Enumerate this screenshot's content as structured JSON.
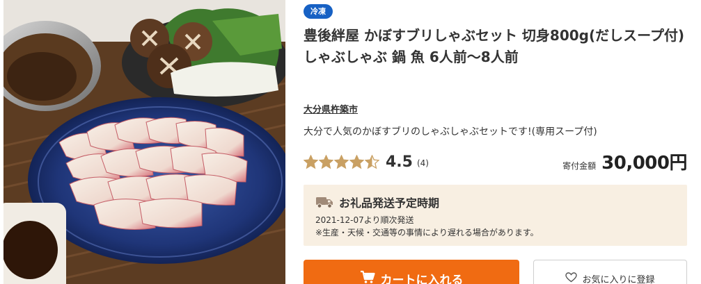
{
  "product": {
    "badge": "冷凍",
    "title": "豊後絆屋 かぼすブリしゃぶセット 切身800g(だしスープ付) しゃぶしゃぶ 鍋 魚 6人前〜8人前",
    "municipality": "大分県杵築市",
    "description": "大分で人気のかぼすブリのしゃぶしゃぶセットです!(専用スープ付)",
    "image_icon": "photo-buri-shabu-shabu-platter"
  },
  "rating": {
    "value": "4.5",
    "count": "(4)",
    "stars": 4.5,
    "star_color": "#c9a063"
  },
  "price": {
    "label": "寄付金額",
    "amount": "30,000円"
  },
  "shipping": {
    "icon": "truck-icon",
    "title": "お礼品発送予定時期",
    "date": "2021-12-07より順次発送",
    "note": "※生産・天候・交通等の事情により遅れる場合があります。",
    "background": "#f8efe2"
  },
  "actions": {
    "cart_label": "カートに入れる",
    "cart_icon": "cart-icon",
    "favorite_label": "お気に入りに登録",
    "favorite_icon": "heart-outline-icon",
    "accent": "#f06b12"
  },
  "colors": {
    "badge": "#1761c4",
    "text": "#333333"
  }
}
